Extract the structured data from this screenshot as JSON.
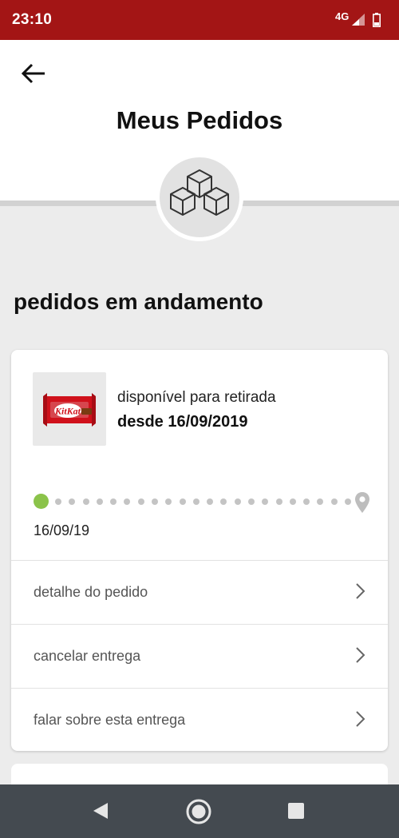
{
  "status_bar": {
    "time": "23:10",
    "network": "4G",
    "background_color": "#a31515",
    "icons": [
      "signal-icon",
      "battery-icon"
    ]
  },
  "header": {
    "back_icon": "arrow-left-icon",
    "title": "Meus Pedidos",
    "badge_icon": "boxes-icon"
  },
  "section": {
    "title": "pedidos em andamento"
  },
  "order": {
    "product_image": "kitkat-chocolate-image",
    "product_brand_text": "KitKat",
    "status_label": "disponível para retirada",
    "status_date": "desde 16/09/2019",
    "timeline": {
      "start_date": "16/09/19",
      "progress_color": "#8bc34a",
      "end_icon": "location-pin-icon",
      "pending_dots": 22
    },
    "actions": [
      {
        "label": "detalhe do pedido",
        "icon": "chevron-right-icon"
      },
      {
        "label": "cancelar entrega",
        "icon": "chevron-right-icon"
      },
      {
        "label": "falar sobre esta entrega",
        "icon": "chevron-right-icon"
      }
    ]
  },
  "nav_bar": {
    "buttons": [
      "back-triangle-icon",
      "home-circle-icon",
      "recents-square-icon"
    ]
  }
}
